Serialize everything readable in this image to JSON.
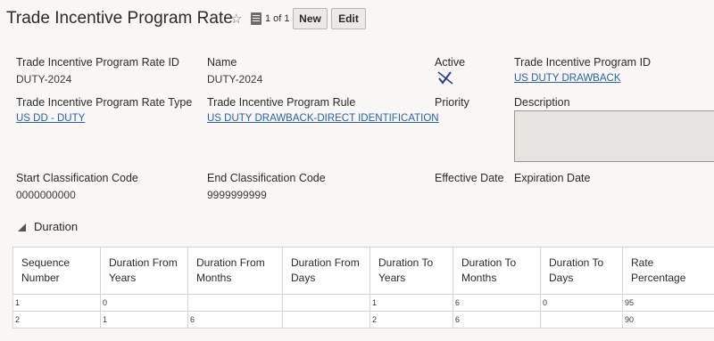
{
  "header": {
    "title": "Trade Incentive Program Rate",
    "favorite_icon": "star-outline-icon",
    "record_count": "1 of 1",
    "new_label": "New",
    "edit_label": "Edit"
  },
  "fields": {
    "rate_id": {
      "label": "Trade Incentive Program Rate ID",
      "value": "DUTY-2024"
    },
    "name": {
      "label": "Name",
      "value": "DUTY-2024"
    },
    "active": {
      "label": "Active",
      "icon": "checkmark-disabled-icon"
    },
    "program_id": {
      "label": "Trade Incentive Program ID",
      "value": "US DUTY DRAWBACK"
    },
    "rate_type": {
      "label": "Trade Incentive Program Rate Type",
      "value": "US DD - DUTY"
    },
    "program_rule": {
      "label": "Trade Incentive Program Rule",
      "value": "US DUTY DRAWBACK-DIRECT IDENTIFICATION"
    },
    "priority": {
      "label": "Priority",
      "value": ""
    },
    "description": {
      "label": "Description",
      "value": ""
    },
    "start_code": {
      "label": "Start Classification Code",
      "value": "0000000000"
    },
    "end_code": {
      "label": "End Classification Code",
      "value": "9999999999"
    },
    "effective_date": {
      "label": "Effective Date",
      "value": ""
    },
    "expiration_date": {
      "label": "Expiration Date",
      "value": ""
    }
  },
  "duration": {
    "title": "Duration",
    "columns": [
      "Sequence Number",
      "Duration From Years",
      "Duration From Months",
      "Duration From Days",
      "Duration To Years",
      "Duration To Months",
      "Duration To Days",
      "Rate Percentage"
    ],
    "rows": [
      [
        "1",
        "0",
        "",
        "",
        "1",
        "6",
        "0",
        "95"
      ],
      [
        "2",
        "1",
        "6",
        "",
        "2",
        "6",
        "",
        "90"
      ]
    ]
  },
  "colors": {
    "link": "#2a60a8",
    "background": "#f8f7f5",
    "description_box": "#e6e4e1"
  }
}
